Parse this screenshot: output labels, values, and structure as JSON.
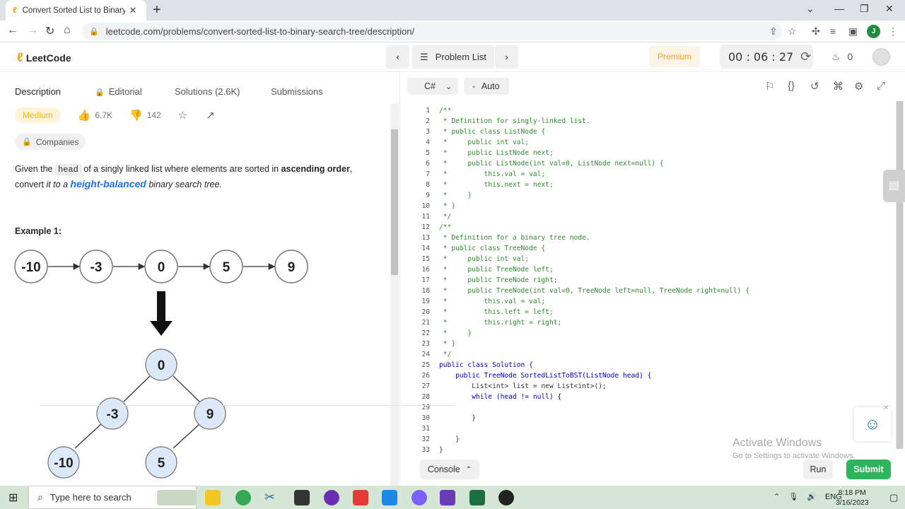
{
  "browser": {
    "tab_title": "Convert Sorted List to Binary Sea",
    "url": "leetcode.com/problems/convert-sorted-list-to-binary-search-tree/description/",
    "profile_initial": "J"
  },
  "header": {
    "logo_text": "LeetCode",
    "problem_list": "Problem List",
    "premium": "Premium",
    "timer": "00 : 06 : 27",
    "streak": "0"
  },
  "tabs": {
    "description": "Description",
    "editorial": "Editorial",
    "solutions": "Solutions (2.6K)",
    "submissions": "Submissions"
  },
  "problem": {
    "difficulty": "Medium",
    "likes": "6.7K",
    "dislikes": "142",
    "companies": "Companies",
    "statement": {
      "p1": "Given the ",
      "code": "head",
      "p2": " of a singly linked list where elements are sorted in ",
      "bold": "ascending order",
      "p3": ", convert ",
      "italic1": "it to a ",
      "hb": "height-balanced",
      "italic2": " binary search tree."
    },
    "example_title": "Example 1:",
    "list_values": [
      "-10",
      "-3",
      "0",
      "5",
      "9"
    ],
    "tree": {
      "root": "0",
      "left": "-3",
      "right": "9",
      "left_left": "-10",
      "right_left": "5"
    }
  },
  "editor": {
    "language": "C#",
    "mode": "Auto",
    "console": "Console",
    "run": "Run",
    "submit": "Submit",
    "lines": [
      {
        "n": "1",
        "t": "/**",
        "c": "cm"
      },
      {
        "n": "2",
        "t": " * Definition for singly-linked list.",
        "c": "cm"
      },
      {
        "n": "3",
        "t": " * public class ListNode {",
        "c": "cm"
      },
      {
        "n": "4",
        "t": " *     public int val;",
        "c": "cm"
      },
      {
        "n": "5",
        "t": " *     public ListNode next;",
        "c": "cm"
      },
      {
        "n": "6",
        "t": " *     public ListNode(int val=0, ListNode next=null) {",
        "c": "cm"
      },
      {
        "n": "7",
        "t": " *         this.val = val;",
        "c": "cm"
      },
      {
        "n": "8",
        "t": " *         this.next = next;",
        "c": "cm"
      },
      {
        "n": "9",
        "t": " *     }",
        "c": "cm"
      },
      {
        "n": "10",
        "t": " * }",
        "c": "cm"
      },
      {
        "n": "11",
        "t": " */",
        "c": "cm"
      },
      {
        "n": "12",
        "t": "/**",
        "c": "cm"
      },
      {
        "n": "13",
        "t": " * Definition for a binary tree node.",
        "c": "cm"
      },
      {
        "n": "14",
        "t": " * public class TreeNode {",
        "c": "cm"
      },
      {
        "n": "15",
        "t": " *     public int val;",
        "c": "cm"
      },
      {
        "n": "16",
        "t": " *     public TreeNode left;",
        "c": "cm"
      },
      {
        "n": "17",
        "t": " *     public TreeNode right;",
        "c": "cm"
      },
      {
        "n": "18",
        "t": " *     public TreeNode(int val=0, TreeNode left=null, TreeNode right=null) {",
        "c": "cm"
      },
      {
        "n": "19",
        "t": " *         this.val = val;",
        "c": "cm"
      },
      {
        "n": "20",
        "t": " *         this.left = left;",
        "c": "cm"
      },
      {
        "n": "21",
        "t": " *         this.right = right;",
        "c": "cm"
      },
      {
        "n": "22",
        "t": " *     }",
        "c": "cm"
      },
      {
        "n": "23",
        "t": " * }",
        "c": "cm"
      },
      {
        "n": "24",
        "t": " */",
        "c": "cm"
      },
      {
        "n": "25",
        "t": "public class Solution {",
        "c": "kw"
      },
      {
        "n": "26",
        "t": "    public TreeNode SortedListToBST(ListNode head) {",
        "c": "kw"
      },
      {
        "n": "27",
        "t": "        List<int> list = new List<int>();",
        "c": "tx"
      },
      {
        "n": "28",
        "t": "        while (head != null) {",
        "c": "kw"
      },
      {
        "n": "29",
        "t": "",
        "c": "tx"
      },
      {
        "n": "30",
        "t": "        }",
        "c": "tx"
      },
      {
        "n": "31",
        "t": "",
        "c": "tx"
      },
      {
        "n": "32",
        "t": "    }",
        "c": "tx"
      },
      {
        "n": "33",
        "t": "}",
        "c": "tx"
      }
    ]
  },
  "watermark": {
    "title": "Activate Windows",
    "subtitle": "Go to Settings to activate Windows."
  },
  "taskbar": {
    "search_placeholder": "Type here to search",
    "language": "ENG",
    "time": "8:18 PM",
    "date": "3/16/2023"
  },
  "colors": {
    "accent_green": "#2db55d",
    "difficulty_medium": "#ffb800",
    "premium": "#ffa116",
    "link_blue": "#1a73e8"
  }
}
